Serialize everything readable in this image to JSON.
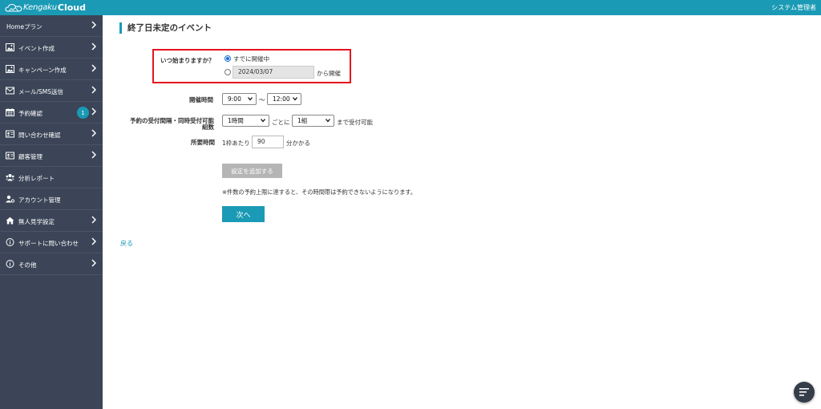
{
  "app": {
    "brand_prefix": "Kengaku",
    "brand_suffix": "Cloud",
    "user_name": "システム管理者"
  },
  "sidebar": {
    "items": [
      {
        "label": "Homeプラン",
        "icon": "none",
        "chevron": true
      },
      {
        "label": "イベント作成",
        "icon": "image-icon",
        "chevron": true
      },
      {
        "label": "キャンペーン作成",
        "icon": "image-icon",
        "chevron": true
      },
      {
        "label": "メール/SMS送信",
        "icon": "mail-icon",
        "chevron": true
      },
      {
        "label": "予約確認",
        "icon": "calendar-icon",
        "chevron": true,
        "badge": "1"
      },
      {
        "label": "問い合わせ確認",
        "icon": "id-card-icon",
        "chevron": true
      },
      {
        "label": "顧客管理",
        "icon": "id-card-icon",
        "chevron": true
      },
      {
        "label": "分析レポート",
        "icon": "users-icon",
        "chevron": false
      },
      {
        "label": "アカウント管理",
        "icon": "user-gear-icon",
        "chevron": false
      },
      {
        "label": "無人見学設定",
        "icon": "home-icon",
        "chevron": true
      },
      {
        "label": "サポートに問い合わせ",
        "icon": "info-icon",
        "chevron": true
      },
      {
        "label": "その他",
        "icon": "info-icon",
        "chevron": true
      }
    ]
  },
  "page": {
    "title": "終了日未定のイベント",
    "start": {
      "label": "いつ始まりますか？",
      "option_now": "すでに開催中",
      "option_date_value": "2024/03/07",
      "option_date_suffix": "から開催"
    },
    "hours": {
      "label": "開催時間",
      "start_value": "9:00",
      "separator": "〜",
      "end_value": "12:00"
    },
    "reservation": {
      "label_line1": "予約の受付間隔・同時受付可能",
      "label_line2": "組数",
      "interval_value": "1時間",
      "interval_suffix": "ごとに",
      "groups_value": "1組",
      "groups_suffix": "まで受付可能"
    },
    "duration": {
      "label": "所要時間",
      "prefix": "1枠あたり",
      "value": "90",
      "suffix": "分かかる"
    },
    "add_setting_button": "設定を追加する",
    "note": "※件数の予約上限に達すると、その時間帯は予約できないようになります。",
    "next_button": "次へ",
    "back_link": "戻る"
  },
  "colors": {
    "brand": "#1a9ab5",
    "sidebar": "#3b4557",
    "highlight": "#e4141e"
  }
}
